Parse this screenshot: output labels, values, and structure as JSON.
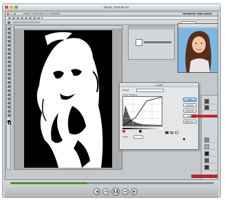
{
  "viewer": {
    "title": "adjust_channel.avi",
    "progress": 0.38
  },
  "photoshop": {
    "window_title": "Adobe Photoshop CS3 Extended",
    "right_title": "Redigerad Vega Naoun"
  },
  "curves_dialog": {
    "title": "Curves",
    "preset_label": "Preset:",
    "graph_label": "Show Clipping",
    "input_label": "Input:",
    "buttons": [
      "OK",
      "Cancel",
      "Smooth",
      "Auto",
      "Options..."
    ]
  },
  "transport": {
    "buttons": [
      "rewind-icon",
      "previous-icon",
      "pause-icon",
      "next-icon",
      "fast-forward-icon"
    ]
  },
  "colors": {
    "accent_red": "#c0262b",
    "sky_blue": "#6fb0dd",
    "progress_green": "#4b8f2c"
  }
}
